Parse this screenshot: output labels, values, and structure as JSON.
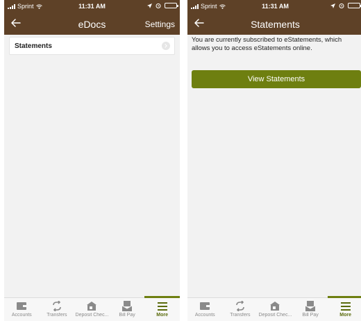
{
  "status_bar": {
    "carrier": "Sprint",
    "time": "11:31 AM"
  },
  "screens": {
    "left": {
      "title": "eDocs",
      "right_action": "Settings",
      "items": [
        {
          "label": "Statements"
        }
      ]
    },
    "right": {
      "title": "Statements",
      "message": "You are currently subscribed to eStatements, which allows you to access eStatements online.",
      "button_label": "View Statements"
    }
  },
  "tab_bar": {
    "items": [
      {
        "label": "Accounts",
        "icon": "wallet-icon"
      },
      {
        "label": "Transfers",
        "icon": "transfer-arrows-icon"
      },
      {
        "label": "Deposit Chec...",
        "icon": "deposit-check-icon"
      },
      {
        "label": "Bill Pay",
        "icon": "bill-pay-icon"
      },
      {
        "label": "More",
        "icon": "hamburger-menu-icon",
        "active": true
      }
    ]
  },
  "colors": {
    "header_brown": "#5e4127",
    "accent_olive": "#6e7f10",
    "background": "#f2f2f2"
  }
}
